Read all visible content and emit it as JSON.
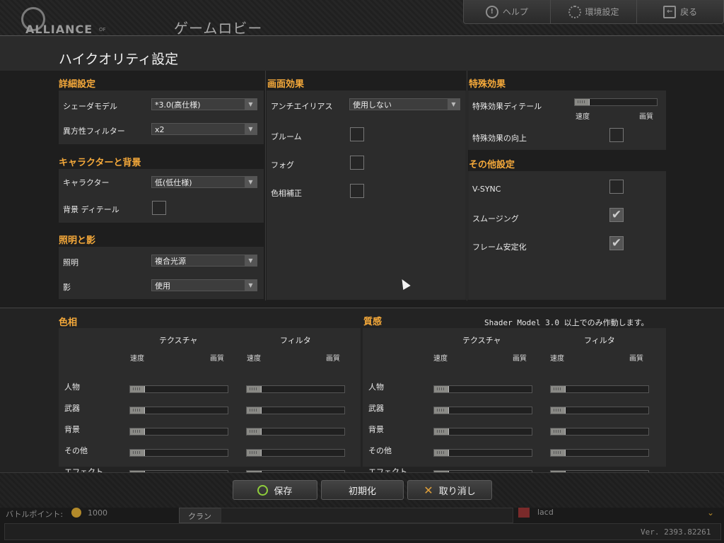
{
  "app": {
    "logo_text": "ALLIANCE",
    "logo_suffix": "OF",
    "lobby_title": "ゲームロビー"
  },
  "topnav": {
    "help": "ヘルプ",
    "settings": "環境設定",
    "back": "戻る"
  },
  "page_title": "ハイクオリティ設定",
  "detail": {
    "title": "詳細設定",
    "shader_label": "シェーダモデル",
    "shader_value": "*3.0(高仕様)",
    "aniso_label": "異方性フィルター",
    "aniso_value": "x2"
  },
  "character_bg": {
    "title": "キャラクターと背景",
    "character_label": "キャラクター",
    "character_value": "低(低仕様)",
    "bg_detail_label": "背景 ディテール",
    "bg_detail_checked": false
  },
  "lighting": {
    "title": "照明と影",
    "light_label": "照明",
    "light_value": "複合光源",
    "shadow_label": "影",
    "shadow_value": "使用"
  },
  "screen_effects": {
    "title": "画面効果",
    "antialias_label": "アンチエイリアス",
    "antialias_value": "使用しない",
    "bloom_label": "ブルーム",
    "fog_label": "フォグ",
    "hue_label": "色相補正"
  },
  "special_effects": {
    "title": "特殊効果",
    "detail_label": "特殊効果ディテール",
    "speed": "速度",
    "quality": "画質",
    "detail_level": 0.1,
    "enhance_label": "特殊効果の向上"
  },
  "other": {
    "title": "その他設定",
    "vsync_label": "V-SYNC",
    "vsync_checked": false,
    "smoothing_label": "スムージング",
    "smoothing_checked": true,
    "frame_label": "フレーム安定化",
    "frame_checked": true
  },
  "hue": {
    "title": "色相",
    "texture": "テクスチャ",
    "filter": "フィルタ",
    "speed": "速度",
    "quality": "画質",
    "rows": [
      "人物",
      "武器",
      "背景",
      "その他",
      "エフェクト"
    ]
  },
  "texture_quality": {
    "title": "質感",
    "note": "Shader Model 3.0 以上でのみ作動します。",
    "texture": "テクスチャ",
    "filter": "フィルタ",
    "speed": "速度",
    "quality": "画質",
    "rows": [
      "人物",
      "武器",
      "背景",
      "その他",
      "エフェクト"
    ]
  },
  "actions": {
    "save": "保存",
    "reset": "初期化",
    "cancel": "取り消し"
  },
  "status": {
    "battle_points_label": "バトルポイント:",
    "battle_points": "1000",
    "clan_tab": "クラン",
    "user": "lacd",
    "version": "Ver. 2393.82261"
  }
}
